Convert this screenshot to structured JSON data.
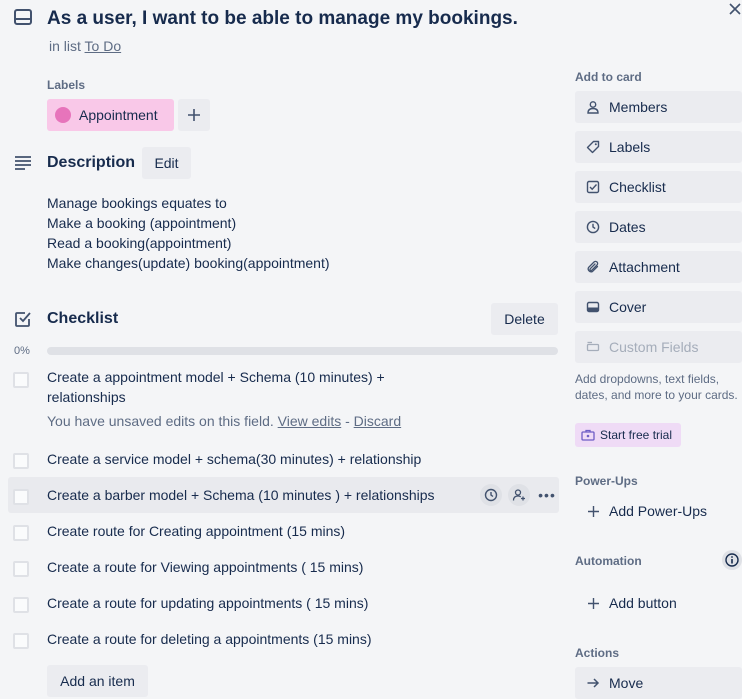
{
  "header": {
    "title": "As a user, I want to be able to manage my bookings.",
    "in_list_prefix": "in list",
    "list_name": "To Do"
  },
  "labels": {
    "heading": "Labels",
    "items": [
      {
        "name": "Appointment",
        "color": "#e774bb",
        "bg": "#f9c8e8"
      }
    ],
    "add_icon": "plus-icon"
  },
  "description": {
    "heading": "Description",
    "edit_label": "Edit",
    "lines": [
      "Manage bookings equates to",
      "Make a booking (appointment)",
      "Read a booking(appointment)",
      "Make changes(update) booking(appointment)"
    ]
  },
  "checklist": {
    "heading": "Checklist",
    "delete_label": "Delete",
    "progress_text": "0%",
    "progress": 0,
    "items": [
      {
        "text": "Create a appointment model + Schema (10 minutes) + relationships",
        "checked": false
      },
      {
        "text": "Create a service model + schema(30 minutes) + relationship",
        "checked": false
      },
      {
        "text": "Create a barber model + Schema (10 minutes ) + relationships",
        "checked": false
      },
      {
        "text": "Create route for Creating appointment (15 mins)",
        "checked": false
      },
      {
        "text": "Create a route for Viewing appointments ( 15 mins)",
        "checked": false
      },
      {
        "text": "Create a route for updating appointments ( 15 mins)",
        "checked": false
      },
      {
        "text": "Create a route for deleting a appointments (15 mins)",
        "checked": false
      }
    ],
    "unsaved": {
      "message": "You have unsaved edits on this field.",
      "view_edits": "View edits",
      "separator": "-",
      "discard": "Discard"
    },
    "add_item_label": "Add an item"
  },
  "sidebar": {
    "add_to_card": {
      "heading": "Add to card",
      "buttons": [
        {
          "label": "Members",
          "icon": "person-icon"
        },
        {
          "label": "Labels",
          "icon": "tag-icon"
        },
        {
          "label": "Checklist",
          "icon": "checklist-icon"
        },
        {
          "label": "Dates",
          "icon": "clock-icon"
        },
        {
          "label": "Attachment",
          "icon": "paperclip-icon"
        },
        {
          "label": "Cover",
          "icon": "cover-icon"
        },
        {
          "label": "Custom Fields",
          "icon": "custom-fields-icon",
          "disabled": true
        }
      ],
      "custom_fields_desc": "Add dropdowns, text fields, dates, and more to your cards.",
      "trial_label": "Start free trial"
    },
    "power_ups": {
      "heading": "Power-Ups",
      "add_label": "Add Power-Ups"
    },
    "automation": {
      "heading": "Automation",
      "add_button_label": "Add button"
    },
    "actions": {
      "heading": "Actions",
      "move_label": "Move"
    }
  }
}
